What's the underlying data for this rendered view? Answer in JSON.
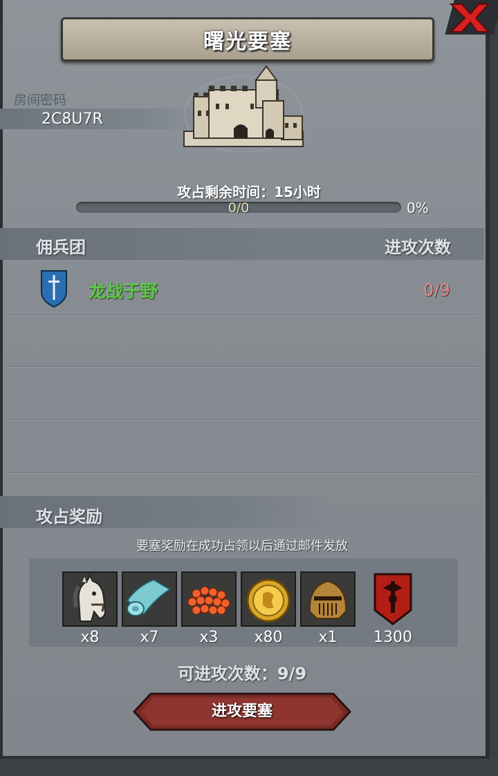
{
  "title": "曙光要塞",
  "room": {
    "label": "房间密码",
    "code": "2C8U7R"
  },
  "timer": "攻占剩余时间：15小时",
  "progress": {
    "text": "0/0",
    "percent_text": "0%",
    "fraction": 0
  },
  "table": {
    "col_guild": "佣兵团",
    "col_attacks": "进攻次数",
    "rows": [
      {
        "name": "龙战于野",
        "attacks": "0/9"
      }
    ]
  },
  "rewards": {
    "title": "攻占奖励",
    "note": "要塞奖励在成功占领以后通过邮件发放",
    "items": [
      {
        "icon": "horse-icon",
        "qty": "x8"
      },
      {
        "icon": "cloth-icon",
        "qty": "x7"
      },
      {
        "icon": "red-gems-icon",
        "qty": "x3"
      },
      {
        "icon": "gold-coin-icon",
        "qty": "x80"
      },
      {
        "icon": "helmet-icon",
        "qty": "x1"
      },
      {
        "icon": "red-banner-icon",
        "qty": "1300"
      }
    ]
  },
  "attack_count": "可进攻次数：9/9",
  "attack_button": "进攻要塞",
  "colors": {
    "guild_name": "#5ec64a",
    "attacks": "#e8868a",
    "button": "#7a2a26"
  }
}
